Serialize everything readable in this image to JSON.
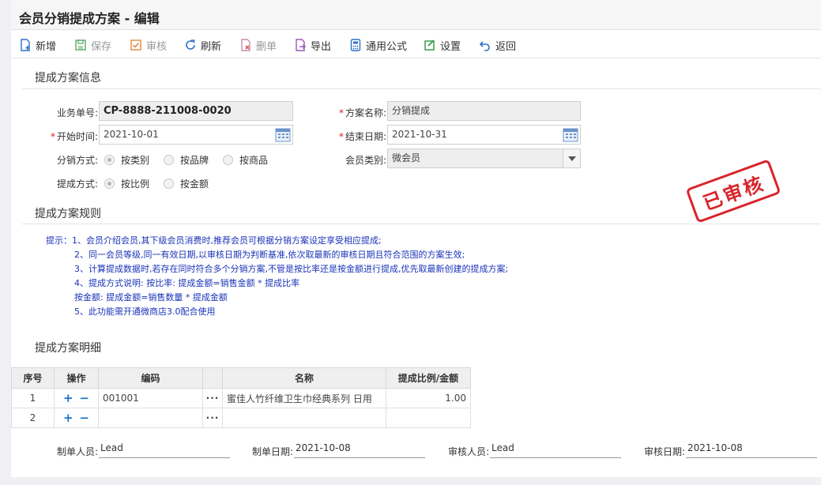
{
  "window": {
    "title": "会员分销提成方案 - 编辑"
  },
  "toolbar": [
    {
      "id": "new",
      "label": "新增",
      "icon": "new-doc-icon",
      "enabled": true
    },
    {
      "id": "save",
      "label": "保存",
      "icon": "save-icon",
      "enabled": false
    },
    {
      "id": "audit",
      "label": "审核",
      "icon": "audit-icon",
      "enabled": false
    },
    {
      "id": "refresh",
      "label": "刷新",
      "icon": "refresh-icon",
      "enabled": true
    },
    {
      "id": "delete",
      "label": "删单",
      "icon": "delete-doc-icon",
      "enabled": false
    },
    {
      "id": "export",
      "label": "导出",
      "icon": "export-icon",
      "enabled": true
    },
    {
      "id": "formula",
      "label": "通用公式",
      "icon": "calculator-icon",
      "enabled": true
    },
    {
      "id": "settings",
      "label": "设置",
      "icon": "settings-icon",
      "enabled": true
    },
    {
      "id": "back",
      "label": "返回",
      "icon": "back-icon",
      "enabled": true
    }
  ],
  "info": {
    "section_title": "提成方案信息",
    "doc_no_label": "业务单号:",
    "doc_no": "CP-8888-211008-0020",
    "plan_name_label": "方案名称:",
    "plan_name": "分销提成",
    "start_label": "开始时间:",
    "start_date": "2021-10-01",
    "end_label": "结束日期:",
    "end_date": "2021-10-31",
    "dist_mode_label": "分销方式:",
    "dist_modes": [
      "按类别",
      "按品牌",
      "按商品"
    ],
    "member_type_label": "会员类别:",
    "member_type": "微会员",
    "comm_mode_label": "提成方式:",
    "comm_modes": [
      "按比例",
      "按金额"
    ],
    "stamp": "已审核"
  },
  "rules": {
    "section_title": "提成方案规则",
    "lines": [
      "提示：1、会员介绍会员,其下级会员消费时,推荐会员可根据分销方案设定享受相应提成;",
      "2、同一会员等级,同一有效日期,以审核日期为判断基准,依次取最新的审核日期且符合范围的方案生效;",
      "3、计算提成数据时,若存在同时符合多个分销方案,不管是按比率还是按金额进行提成,优先取最新创建的提成方案;",
      "4、提成方式说明: 按比率: 提成金额=销售金额 * 提成比率",
      "按金额: 提成金额=销售数量 * 提成金额",
      "5、此功能需开通微商店3.0配合使用"
    ]
  },
  "detail": {
    "section_title": "提成方案明细",
    "columns": [
      "序号",
      "操作",
      "编码",
      "名称",
      "提成比例/金额"
    ],
    "rows": [
      {
        "no": "1",
        "code": "001001",
        "name": "蜜佳人竹纤维卫生巾经典系列 日用",
        "value": "1.00"
      },
      {
        "no": "2",
        "code": "",
        "name": "",
        "value": ""
      }
    ],
    "add_glyph": "+",
    "remove_glyph": "−",
    "more_glyph": "···"
  },
  "footer": {
    "maker_label": "制单人员:",
    "maker": "Lead",
    "make_date_label": "制单日期:",
    "make_date": "2021-10-08",
    "auditor_label": "审核人员:",
    "auditor": "Lead",
    "audit_date_label": "审核日期:",
    "audit_date": "2021-10-08"
  },
  "colors": {
    "accent": "#1a73d0",
    "stamp": "#d9242b",
    "rules_text": "#1a33b8"
  }
}
